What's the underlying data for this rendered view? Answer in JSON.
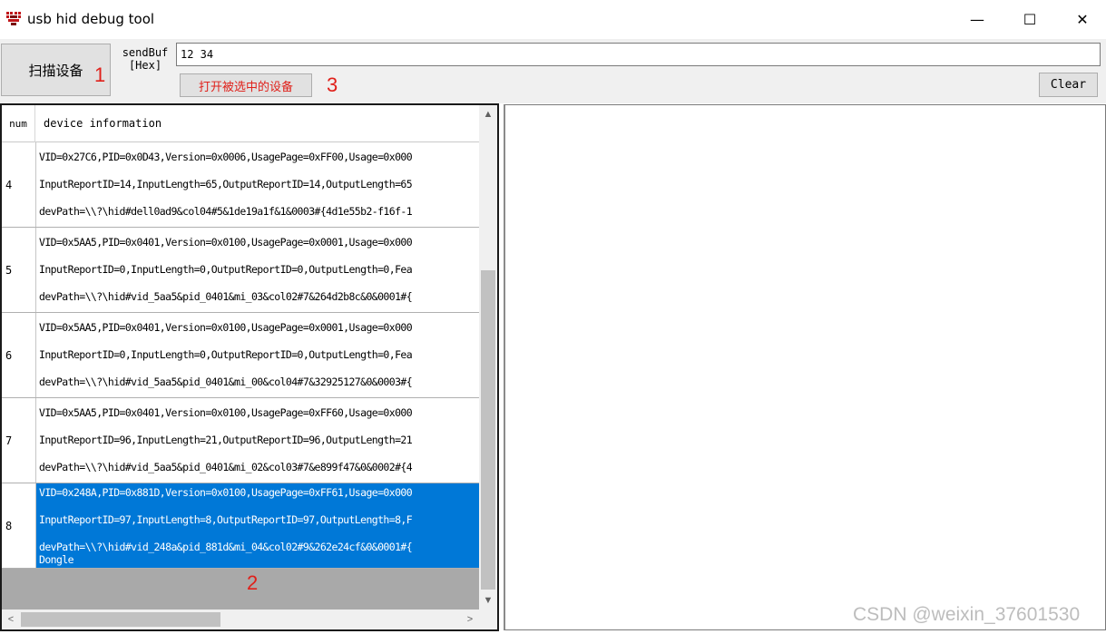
{
  "window": {
    "title": "usb hid debug tool",
    "minimize_glyph": "—",
    "maximize_glyph": "☐",
    "close_glyph": "✕"
  },
  "toolbar": {
    "scan_button_label": "扫描设备",
    "sendbuf_label_line1": "sendBuf",
    "sendbuf_label_line2": "[Hex]",
    "sendbuf_value": "12 34",
    "open_button_label": "打开被选中的设备",
    "clear_button_label": "Clear"
  },
  "annotations": {
    "one": "1",
    "two": "2",
    "three": "3"
  },
  "device_list": {
    "headers": {
      "num": "num",
      "info": "device information"
    },
    "rows": [
      {
        "num": "4",
        "lines": [
          "VID=0x27C6,PID=0x0D43,Version=0x0006,UsagePage=0xFF00,Usage=0x000",
          "InputReportID=14,InputLength=65,OutputReportID=14,OutputLength=65",
          "devPath=\\\\?\\hid#dell0ad9&col04#5&1de19a1f&1&0003#{4d1e55b2-f16f-1"
        ]
      },
      {
        "num": "5",
        "lines": [
          "VID=0x5AA5,PID=0x0401,Version=0x0100,UsagePage=0x0001,Usage=0x000",
          "InputReportID=0,InputLength=0,OutputReportID=0,OutputLength=0,Fea",
          "devPath=\\\\?\\hid#vid_5aa5&pid_0401&mi_03&col02#7&264d2b8c&0&0001#{"
        ]
      },
      {
        "num": "6",
        "lines": [
          "VID=0x5AA5,PID=0x0401,Version=0x0100,UsagePage=0x0001,Usage=0x000",
          "InputReportID=0,InputLength=0,OutputReportID=0,OutputLength=0,Fea",
          "devPath=\\\\?\\hid#vid_5aa5&pid_0401&mi_00&col04#7&32925127&0&0003#{"
        ]
      },
      {
        "num": "7",
        "lines": [
          "VID=0x5AA5,PID=0x0401,Version=0x0100,UsagePage=0xFF60,Usage=0x000",
          "InputReportID=96,InputLength=21,OutputReportID=96,OutputLength=21",
          "devPath=\\\\?\\hid#vid_5aa5&pid_0401&mi_02&col03#7&e899f47&0&0002#{4"
        ]
      },
      {
        "num": "8",
        "selected": true,
        "lines": [
          "VID=0x248A,PID=0x881D,Version=0x0100,UsagePage=0xFF61,Usage=0x000",
          "InputReportID=97,InputLength=8,OutputReportID=97,OutputLength=8,F",
          "devPath=\\\\?\\hid#vid_248a&pid_881d&mi_04&col02#9&262e24cf&0&0001#{",
          "Dongle"
        ]
      }
    ]
  },
  "scrollbars": {
    "up": "▲",
    "down": "▼",
    "left": "<",
    "right": ">"
  },
  "watermark": "CSDN @weixin_37601530",
  "colors": {
    "selection": "#0078d7",
    "annotation": "#e0201a",
    "list_background": "#a9a9a9"
  }
}
